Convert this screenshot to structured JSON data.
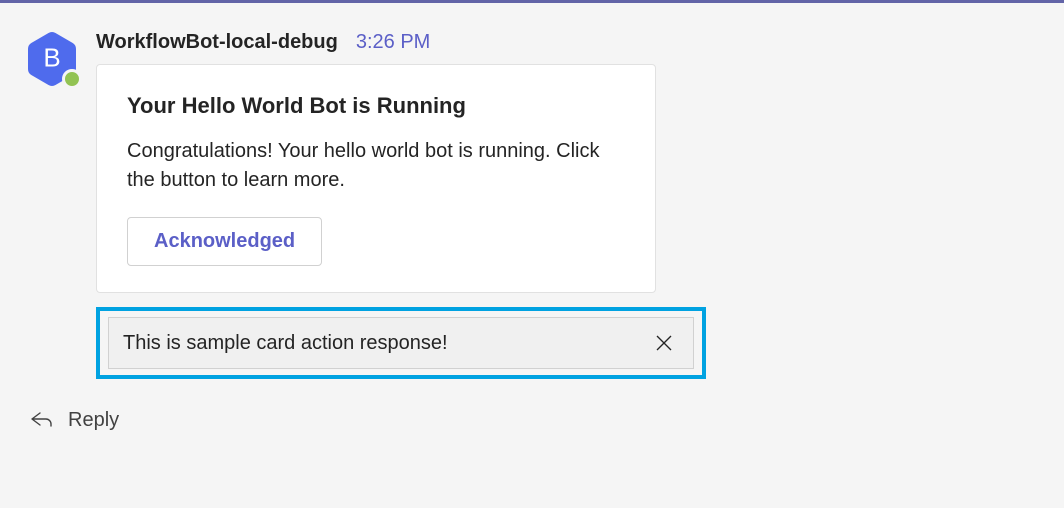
{
  "avatar": {
    "initial": "B",
    "bg_color": "#4f6bed"
  },
  "header": {
    "bot_name": "WorkflowBot-local-debug",
    "timestamp": "3:26 PM"
  },
  "card": {
    "title": "Your Hello World Bot is Running",
    "body": "Congratulations! Your hello world bot is running. Click the button to learn more.",
    "button_label": "Acknowledged"
  },
  "toast": {
    "text": "This is sample card action response!"
  },
  "reply": {
    "label": "Reply"
  },
  "colors": {
    "accent": "#5b5fc7",
    "highlight": "#00a2e1",
    "presence": "#92c353"
  }
}
